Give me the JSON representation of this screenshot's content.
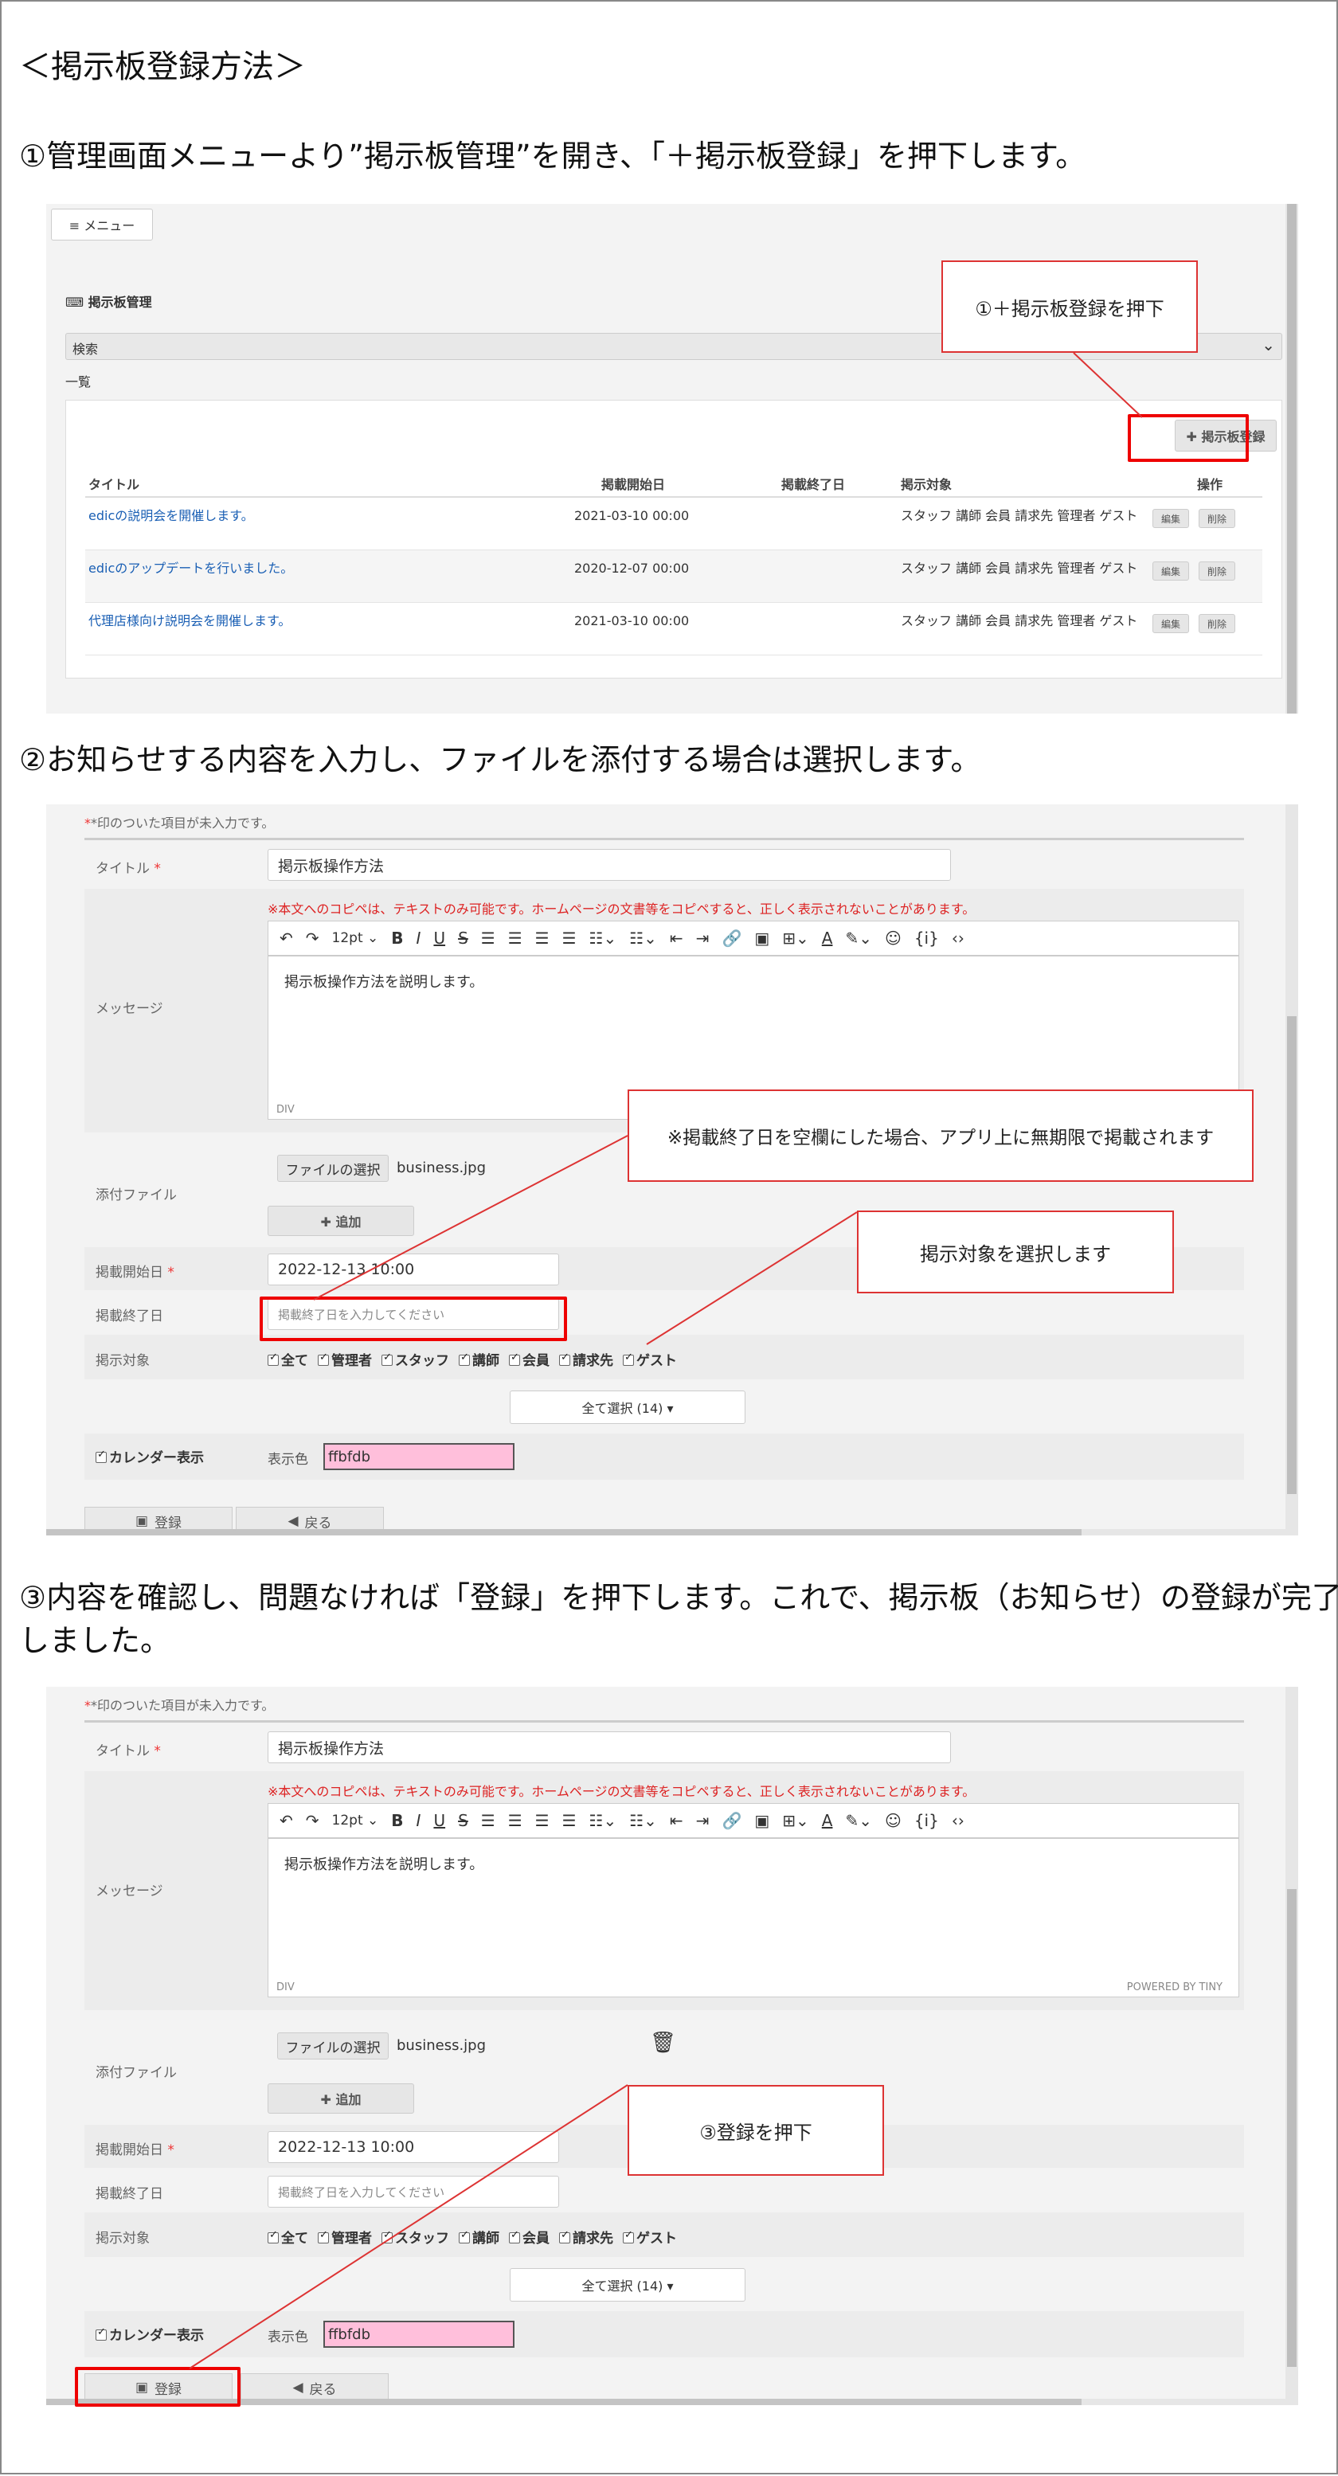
{
  "page_title": "＜掲示板登録方法＞",
  "step1": {
    "text": "①管理画面メニューより”掲示板管理”を開き、「＋掲示板登録」を押下します。",
    "menu_label": "≡ メニュー",
    "section_title": "掲示板管理",
    "search_label": "検索",
    "list_label": "一覧",
    "add_button_label": "✚ 掲示板登録",
    "callout": "①＋掲示板登録を押下",
    "table": {
      "headers": [
        "タイトル",
        "掲載開始日",
        "掲載終了日",
        "掲示対象",
        "操作"
      ],
      "rows": [
        {
          "title": "edicの説明会を開催します。",
          "start": "2021-03-10 00:00",
          "end": "",
          "target": "スタッフ 講師 会員 請求先 管理者 ゲスト"
        },
        {
          "title": "edicのアップデートを行いました。",
          "start": "2020-12-07 00:00",
          "end": "",
          "target": "スタッフ 講師 会員 請求先 管理者 ゲスト"
        },
        {
          "title": "代理店様向け説明会を開催します。",
          "start": "2021-03-10 00:00",
          "end": "",
          "target": "スタッフ 講師 会員 請求先 管理者 ゲスト"
        }
      ],
      "edit_label": "編集",
      "delete_label": "削除"
    }
  },
  "step2": {
    "text": "②お知らせする内容を入力し、ファイルを添付する場合は選択します。",
    "callout_end": "※掲載終了日を空欄にした場合、アプリ上に無期限で掲載されます",
    "callout_target": "掲示対象を選択します"
  },
  "step3": {
    "text_line1": "③内容を確認し、問題なければ「登録」を押下します。これで、掲示板（お知らせ）の登録が完了",
    "text_line2": "しました。",
    "callout": "③登録を押下",
    "powered": "POWERED BY TINY"
  },
  "form": {
    "required_note": "*印のついた項目が未入力です。",
    "title_label": "タイトル",
    "title_value": "掲示板操作方法",
    "message_label": "メッセージ",
    "warning": "※本文へのコピペは、テキストのみ可能です。ホームページの文書等をコピペすると、正しく表示されないことがあります。",
    "font_size": "12pt",
    "message_value": "掲示板操作方法を説明します。",
    "editor_path": "DIV",
    "attach_label": "添付ファイル",
    "file_button": "ファイルの選択",
    "file_name": "business.jpg",
    "add_label": "✚ 追加",
    "start_label": "掲載開始日",
    "start_value": "2022-12-13 10:00",
    "end_label": "掲載終了日",
    "end_placeholder": "掲載終了日を入力してください",
    "target_label": "掲示対象",
    "targets": [
      "全て",
      "管理者",
      "スタッフ",
      "講師",
      "会員",
      "請求先",
      "ゲスト"
    ],
    "select_all": "全て選択 (14) ▾",
    "calendar_label": "カレンダー表示",
    "color_label": "表示色",
    "color_value": "ffbfdb",
    "submit_label": "登録",
    "back_label": "戻る"
  },
  "colors": {
    "accent_red": "#e00000",
    "link": "#1a5fb4",
    "highlight": "#ffbfdb"
  }
}
